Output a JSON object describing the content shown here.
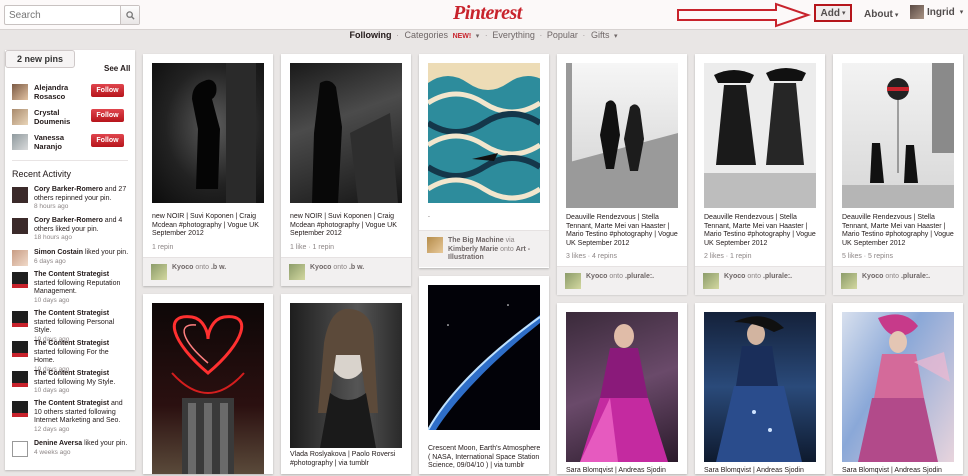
{
  "header": {
    "search_placeholder": "Search",
    "logo": "Pinterest",
    "add_label": "Add",
    "about_label": "About",
    "user_name": "Ingrid",
    "accent_color": "#c8232c"
  },
  "subnav": {
    "following": "Following",
    "categories": "Categories",
    "new_badge": "NEW!",
    "everything": "Everything",
    "popular": "Popular",
    "gifts": "Gifts"
  },
  "sidebar": {
    "new_pins": "2 new pins",
    "see_all": "See All",
    "follow_label": "Follow",
    "suggestions": [
      {
        "name": "Alejandra Rosasco"
      },
      {
        "name": "Crystal Doumenis"
      },
      {
        "name": "Vanessa Naranjo"
      }
    ],
    "recent_title": "Recent Activity",
    "activity": [
      {
        "who": "Cory Barker-Romero",
        "text": " and 27 others repinned your pin.",
        "time": "8 hours ago"
      },
      {
        "who": "Cory Barker-Romero",
        "text": " and 4 others liked your pin.",
        "time": "18 hours ago"
      },
      {
        "who": "Simon Costain",
        "text": " liked your pin.",
        "time": "6 days ago"
      },
      {
        "who": "The Content Strategist",
        "text": " started following Reputation Management.",
        "time": "10 days ago"
      },
      {
        "who": "The Content Strategist",
        "text": " started following Personal Style.",
        "time": "10 days ago"
      },
      {
        "who": "The Content Strategist",
        "text": " started following For the Home.",
        "time": "10 days ago"
      },
      {
        "who": "The Content Strategist",
        "text": " started following My Style.",
        "time": "10 days ago"
      },
      {
        "who": "The Content Strategist",
        "text": " and 10 others started following Internet Marketing and Seo.",
        "time": "12 days ago"
      },
      {
        "who": "Denine Aversa",
        "text": " liked your pin.",
        "time": "4 weeks ago"
      }
    ]
  },
  "pins": [
    {
      "caption": "new NOIR | Suvi Koponen | Craig Mcdean #photography | Vogue UK September 2012",
      "stats": "1 repin",
      "user": "Kyoco",
      "board": ".b w.",
      "via": ""
    },
    {
      "caption": "new NOIR | Suvi Koponen | Craig Mcdean #photography | Vogue UK September 2012",
      "stats": "1 like · 1 repin",
      "user": "Kyoco",
      "board": ".b w.",
      "via": ""
    },
    {
      "caption": ".",
      "stats": "",
      "user": "The Big Machine",
      "board": "Art - Illustration",
      "via": "Kimberly Marie"
    },
    {
      "caption": "Deauville Rendezvous | Stella Tennant, Marte Mei van Haaster | Mario Testino #photography | Vogue UK September 2012",
      "stats": "3 likes · 4 repins",
      "user": "Kyoco",
      "board": ".plurale:.",
      "via": ""
    },
    {
      "caption": "Deauville Rendezvous | Stella Tennant, Marte Mei van Haaster | Mario Testino #photography | Vogue UK September 2012",
      "stats": "2 likes · 1 repin",
      "user": "Kyoco",
      "board": ".plurale:.",
      "via": ""
    },
    {
      "caption": "Deauville Rendezvous | Stella Tennant, Marte Mei van Haaster | Mario Testino #photography | Vogue UK September 2012",
      "stats": "5 likes · 5 repins",
      "user": "Kyoco",
      "board": ".plurale:.",
      "via": ""
    },
    {
      "caption": "",
      "stats": "",
      "user": "",
      "board": "",
      "via": ""
    },
    {
      "caption": "Vlada Roslyakova | Paolo Roversi #photography | via tumblr",
      "stats": "",
      "user": "",
      "board": "",
      "via": ""
    },
    {
      "caption": "Crescent Moon, Earth's Atmosphere ( NASA, International Space Station Science, 09/04/10 ) | via tumblr",
      "stats": "",
      "user": "",
      "board": "",
      "via": ""
    },
    {
      "caption": "Sara Blomqvist | Andreas Sjodin",
      "stats": "",
      "user": "",
      "board": "",
      "via": ""
    },
    {
      "caption": "Sara Blomqvist | Andreas Sjodin",
      "stats": "",
      "user": "",
      "board": "",
      "via": ""
    },
    {
      "caption": "Sara Blomqvist | Andreas Sjodin",
      "stats": "",
      "user": "",
      "board": "",
      "via": ""
    }
  ],
  "attr_words": {
    "onto": "onto",
    "via": "via"
  }
}
